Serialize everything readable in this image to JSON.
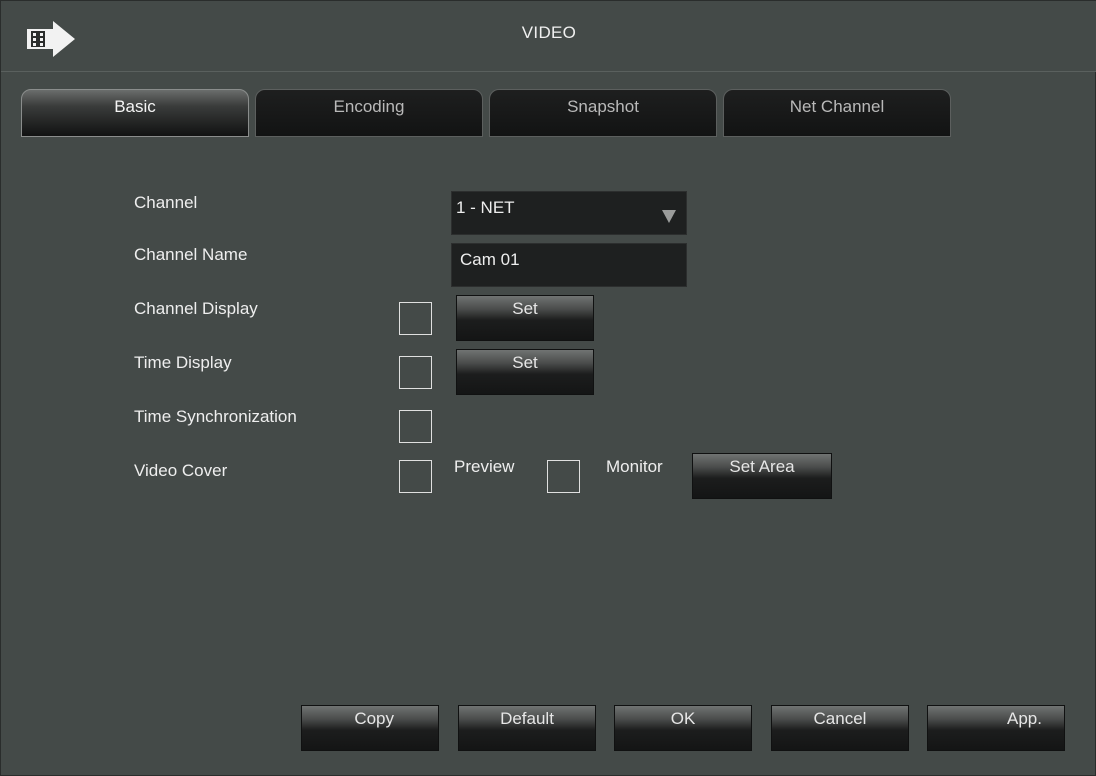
{
  "window": {
    "title": "VIDEO",
    "icon": "film-arrow-icon"
  },
  "tabs": [
    {
      "label": "Basic",
      "active": true
    },
    {
      "label": "Encoding",
      "active": false
    },
    {
      "label": "Snapshot",
      "active": false
    },
    {
      "label": "Net Channel",
      "active": false
    }
  ],
  "form": {
    "channel_label": "Channel",
    "channel_value": "1 - NET",
    "channel_name_label": "Channel Name",
    "channel_name_value": "Cam 01",
    "channel_display_label": "Channel Display",
    "channel_display_checked": false,
    "channel_display_set": "Set",
    "time_display_label": "Time Display",
    "time_display_checked": false,
    "time_display_set": "Set",
    "time_sync_label": "Time Synchronization",
    "time_sync_checked": false,
    "video_cover_label": "Video Cover",
    "video_cover_checked": false,
    "preview_label": "Preview",
    "preview_checked": false,
    "monitor_label": "Monitor",
    "set_area": "Set Area"
  },
  "footer": {
    "copy": "Copy",
    "default": "Default",
    "ok": "OK",
    "cancel": "Cancel",
    "apply": "App."
  },
  "colors": {
    "background": "#444a48",
    "field_bg": "#1e2020",
    "text": "#eeeeee"
  }
}
